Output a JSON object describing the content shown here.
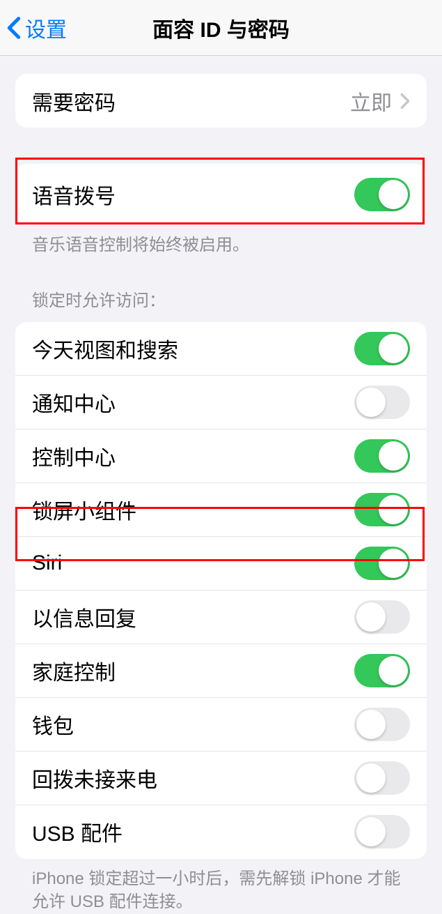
{
  "nav": {
    "back_label": "设置",
    "title": "面容 ID 与密码"
  },
  "require_passcode": {
    "label": "需要密码",
    "value": "立即"
  },
  "voice_dial": {
    "label": "语音拨号",
    "footer": "音乐语音控制将始终被启用。"
  },
  "lock_section": {
    "header": "锁定时允许访问：",
    "items": [
      {
        "label": "今天视图和搜索",
        "on": true
      },
      {
        "label": "通知中心",
        "on": false
      },
      {
        "label": "控制中心",
        "on": true
      },
      {
        "label": "锁屏小组件",
        "on": true
      },
      {
        "label": "Siri",
        "on": true
      },
      {
        "label": "以信息回复",
        "on": false
      },
      {
        "label": "家庭控制",
        "on": true
      },
      {
        "label": "钱包",
        "on": false
      },
      {
        "label": "回拨未接来电",
        "on": false
      },
      {
        "label": "USB 配件",
        "on": false
      }
    ],
    "footer": "iPhone 锁定超过一小时后，需先解锁 iPhone 才能允许 USB 配件连接。"
  }
}
